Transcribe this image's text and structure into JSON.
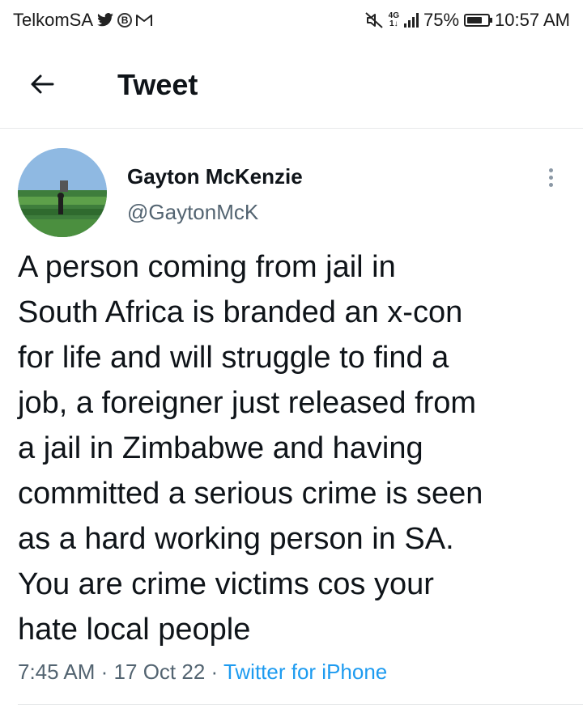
{
  "status_bar": {
    "carrier": "TelkomSA",
    "network_label_top": "4G",
    "network_label_bottom": "1↓",
    "battery_text": "75%",
    "battery_level": 0.75,
    "time": "10:57 AM",
    "notification_icons": [
      "twitter-icon",
      "b-badge-icon",
      "gmail-icon"
    ],
    "badge_letter": "B"
  },
  "header": {
    "title": "Tweet"
  },
  "tweet": {
    "author_name": "Gayton McKenzie",
    "author_handle": "@GaytonMcK",
    "text_lines": [
      "A person coming from jail in",
      "South Africa is branded an x-con",
      "for life and will struggle to find a",
      "job, a foreigner just released from",
      "a jail in Zimbabwe and having",
      "committed a serious crime is seen",
      "as a hard working person in SA.",
      "You are crime victims cos your",
      "hate local people"
    ],
    "time": "7:45 AM",
    "separator": "·",
    "date": "17 Oct 22",
    "source": "Twitter for iPhone"
  },
  "colors": {
    "text_primary": "#0f1419",
    "text_secondary": "#536471",
    "link": "#1d9bf0",
    "divider": "#e7e9ea"
  }
}
